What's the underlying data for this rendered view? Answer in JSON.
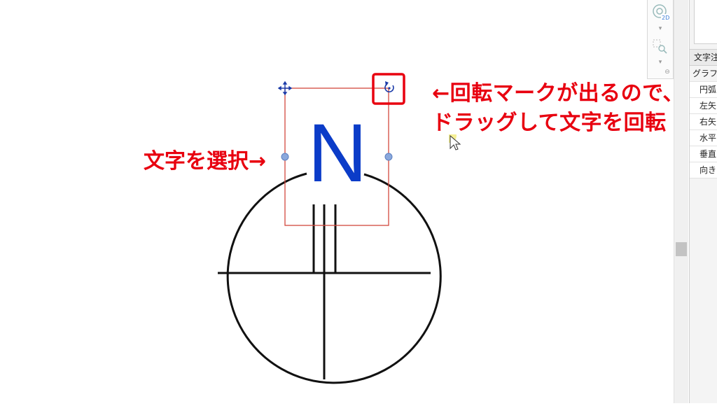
{
  "annotations": {
    "rotate_line1": "←回転マークが出るので、",
    "rotate_line2": "ドラッグして文字を回転",
    "select_label": "文字を選択→"
  },
  "drawing": {
    "north_letter": "N"
  },
  "side_panel": {
    "header": "文字注",
    "group": "グラフィ",
    "items": [
      "円弧",
      "左矢",
      "右矢",
      "水平",
      "垂直",
      "向き"
    ]
  },
  "colors": {
    "annotation_red": "#e8000f",
    "north_blue": "#0b3cc8",
    "handle_blue": "#8aa8dc",
    "selection_red": "#d2473d"
  },
  "icons": {
    "move_handle": "move-crosshair-icon",
    "rotate_handle": "rotate-icon",
    "steering_wheel": "steering-wheel-2d-icon",
    "zoom": "zoom-region-icon"
  }
}
